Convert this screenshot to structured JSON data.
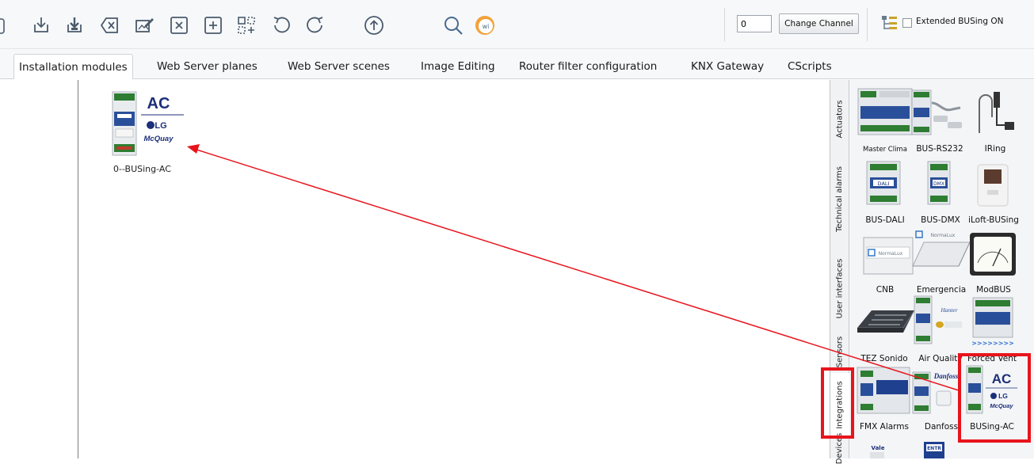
{
  "toolbar": {
    "icons": [
      "partial-edge-icon",
      "download-icon",
      "download-filled-icon",
      "backspace-icon",
      "edit-image-icon",
      "close-box-icon",
      "add-box-icon",
      "layout-icon",
      "undo-icon",
      "redo-icon",
      "upload-circle-icon",
      "search-icon",
      "wi-logo-icon"
    ],
    "channel_value": "0",
    "change_channel_label": "Change Channel",
    "extended_busing_label": "Extended BUSing ON"
  },
  "tabs": [
    {
      "label": "Installation modules",
      "active": true
    },
    {
      "label": "Web Server planes",
      "active": false
    },
    {
      "label": "Web Server scenes",
      "active": false
    },
    {
      "label": "Image Editing",
      "active": false
    },
    {
      "label": "Router filter configuration",
      "active": false
    },
    {
      "label": "KNX Gateway",
      "active": false
    },
    {
      "label": "CScripts",
      "active": false
    }
  ],
  "canvas": {
    "placed_module": {
      "label": "0--BUSing-AC",
      "ac_text": "AC",
      "lg_text": "LG",
      "mcquay_text": "McQuay"
    }
  },
  "palette": {
    "vertical_tabs": [
      "Actuators",
      "Technical alarms",
      "User interfaces",
      "Sensors",
      "Integrations",
      "Devices"
    ],
    "active_tab": "Integrations",
    "items": [
      {
        "label": "Master Clima"
      },
      {
        "label": "BUS-RS232"
      },
      {
        "label": "IRing"
      },
      {
        "label": "BUS-DALI",
        "chip": "DALI"
      },
      {
        "label": "BUS-DMX",
        "chip": "DMX"
      },
      {
        "label": "iLoft-BUSing"
      },
      {
        "label": "CNB",
        "caption": "NormaLux"
      },
      {
        "label": "Emergencia",
        "caption": "NormaLux"
      },
      {
        "label": "ModBUS"
      },
      {
        "label": "TEZ Sonido"
      },
      {
        "label": "Air Quality",
        "caption": "Hanter"
      },
      {
        "label": "Forced Vent",
        "caption": ">>>>>>>>"
      },
      {
        "label": "FMX Alarms"
      },
      {
        "label": "Danfoss",
        "caption": "Danfoss"
      },
      {
        "label": "BUSing-AC",
        "ac_text": "AC",
        "lg_text": "LG",
        "mcquay_text": "McQuay"
      }
    ],
    "bottom_chip": "ENTR",
    "bottom_caption": "Vale"
  },
  "colors": {
    "highlight": "#e8141c",
    "arrow": "#e8141c",
    "module_green": "#2e7d32",
    "module_blue": "#1f3f8f",
    "brand_navy": "#1c2f7a"
  }
}
